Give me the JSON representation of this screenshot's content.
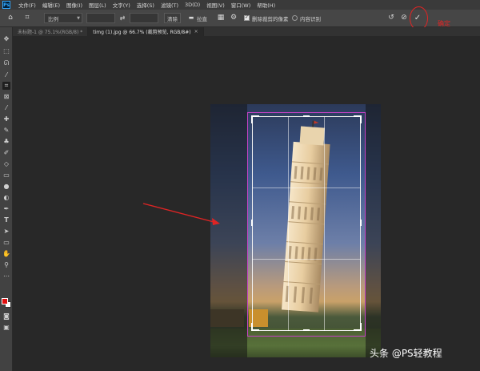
{
  "app": {
    "logo": "Ps"
  },
  "menu": [
    "文件(F)",
    "编辑(E)",
    "图像(I)",
    "图层(L)",
    "文字(Y)",
    "选择(S)",
    "滤镜(T)",
    "3D(D)",
    "视图(V)",
    "窗口(W)",
    "帮助(H)"
  ],
  "options": {
    "ratio_select": "比例",
    "width_value": "",
    "height_value": "",
    "clear_label": "清除",
    "straighten_label": "拉直",
    "delete_pixels_label": "删除裁剪的像素",
    "content_aware_label": "内容识别",
    "delete_pixels_checked": true,
    "content_aware_checked": false
  },
  "annotation": {
    "confirm_note": "确定",
    "circle_color": "#e02424",
    "arrow_color": "#e02424"
  },
  "tabs": [
    {
      "label": "未标题-1 @ 75.1%(RGB/8) *",
      "active": false
    },
    {
      "label": "timg (1).jpg @ 66.7% (裁剪预览, RGB/8#)",
      "active": true
    }
  ],
  "toolbar": {
    "tools": [
      "move-icon",
      "marquee-icon",
      "lasso-icon",
      "magic-wand-icon",
      "crop-icon",
      "frame-icon",
      "eyedropper-icon",
      "healing-icon",
      "brush-icon",
      "stamp-icon",
      "history-brush-icon",
      "eraser-icon",
      "gradient-icon",
      "blur-icon",
      "dodge-icon",
      "pen-icon",
      "type-icon",
      "path-select-icon",
      "rectangle-icon",
      "hand-icon",
      "zoom-icon",
      "more-icon"
    ],
    "foreground_color": "#e01010",
    "background_color": "#ffffff"
  },
  "crop": {
    "frame_color": "#c542c5"
  },
  "watermark": "头条 @PS轻教程"
}
